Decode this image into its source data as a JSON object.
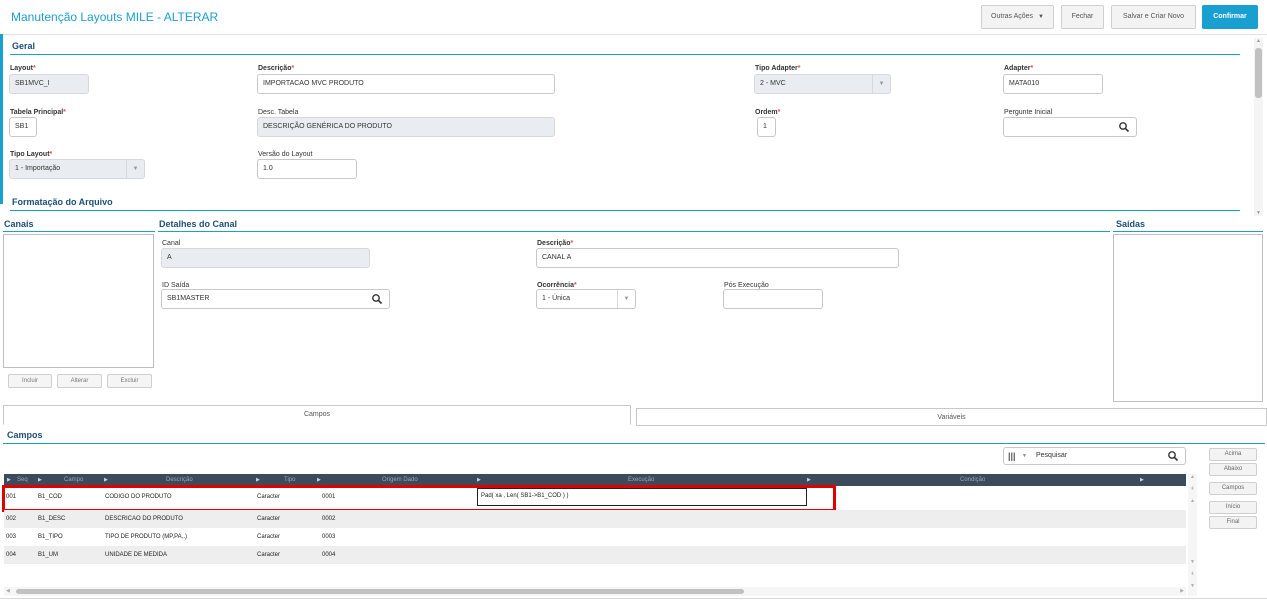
{
  "page": {
    "title": "Manutenção Layouts MILE - ALTERAR",
    "buttons": {
      "outras": "Outras Ações",
      "fechar": "Fechar",
      "salvar": "Salvar e Criar Novo",
      "confirmar": "Confirmar"
    }
  },
  "geral": {
    "title": "Geral",
    "layout": {
      "label": "Layout",
      "value": "SB1MVC_I"
    },
    "descricao": {
      "label": "Descrição",
      "value": "IMPORTACAO MVC PRODUTO"
    },
    "tipo_adapter": {
      "label": "Tipo Adapter",
      "value": "2 - MVC"
    },
    "adapter": {
      "label": "Adapter",
      "value": "MATA010"
    },
    "tabela": {
      "label": "Tabela Principal",
      "value": "SB1"
    },
    "desc_tabela": {
      "label": "Desc. Tabela",
      "value": "DESCRIÇÃO GENÉRICA DO PRODUTO"
    },
    "ordem": {
      "label": "Ordem",
      "value": "1"
    },
    "pergunte": {
      "label": "Pergunte Inicial",
      "value": ""
    },
    "tipo_layout": {
      "label": "Tipo Layout",
      "value": "1 - Importação"
    },
    "versao": {
      "label": "Versão do Layout",
      "value": "1.0"
    }
  },
  "formatacao": {
    "title": "Formatação do Arquivo"
  },
  "canais": {
    "title": "Canais",
    "buttons": {
      "incluir": "Incluir",
      "alterar": "Alterar",
      "excluir": "Excluir"
    }
  },
  "detalhes": {
    "title": "Detalhes do Canal",
    "canal": {
      "label": "Canal",
      "value": "A"
    },
    "descricao": {
      "label": "Descrição",
      "value": "CANAL A"
    },
    "id_saida": {
      "label": "ID Saída",
      "value": "SB1MASTER"
    },
    "ocorrencia": {
      "label": "Ocorrência",
      "value": "1 - Única"
    },
    "pos_execucao": {
      "label": "Pós Execução",
      "value": ""
    }
  },
  "saidas": {
    "title": "Saídas"
  },
  "tabs": {
    "campos": "Campos",
    "variaveis": "Variáveis"
  },
  "campos": {
    "title": "Campos",
    "search_placeholder": "Pesquisar",
    "columns": [
      "Seq",
      "Campo",
      "Descrição",
      "Tipo",
      "Origem Dado",
      "Execução",
      "Condição"
    ],
    "rows": [
      {
        "seq": "001",
        "campo": "B1_COD",
        "descricao": "CODIGO DO PRODUTO",
        "tipo": "Caracter",
        "origem": "0001",
        "execucao": "Pad( xa , Len( SB1->B1_COD ) )"
      },
      {
        "seq": "002",
        "campo": "B1_DESC",
        "descricao": "DESCRICAO DO PRODUTO",
        "tipo": "Caracter",
        "origem": "0002",
        "execucao": ""
      },
      {
        "seq": "003",
        "campo": "B1_TIPO",
        "descricao": "TIPO DE PRODUTO (MP,PA,.)",
        "tipo": "Caracter",
        "origem": "0003",
        "execucao": ""
      },
      {
        "seq": "004",
        "campo": "B1_UM",
        "descricao": "UNIDADE DE MEDIDA",
        "tipo": "Caracter",
        "origem": "0004",
        "execucao": ""
      }
    ],
    "side_buttons": {
      "acima": "Acima",
      "abaixo": "Abaixo",
      "campos": "Campos",
      "inicio": "Início",
      "final": "Final"
    }
  },
  "colors": {
    "accent": "#1a9fd1",
    "header_dark": "#3c4b5c",
    "highlight": "#e00000"
  }
}
